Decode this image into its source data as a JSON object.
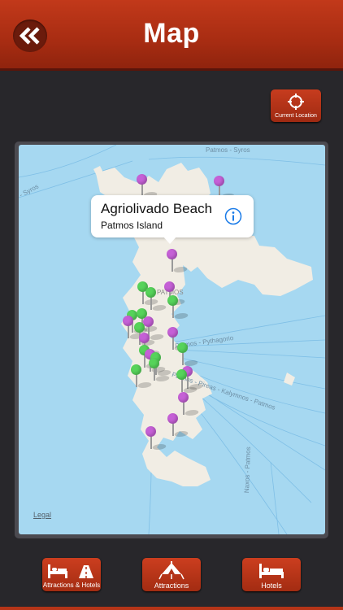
{
  "header": {
    "title": "Map",
    "back_icon": "double-chevron-left-icon"
  },
  "current_location": {
    "label": "Current Location",
    "icon": "crosshair-icon"
  },
  "map": {
    "labels": {
      "patmos_syros": "Patmos - Syros",
      "syros": "- Syros",
      "patmos": "PATMOS",
      "patmos_pythagorio": "Patmos - Pythagorio",
      "patmos_pireas": "Patmos - Pireas - Kalymnos - Patmos",
      "naxos_patmos": "Naxos - Patmos",
      "legal": "Legal"
    },
    "callout": {
      "title": "Agriolivado Beach",
      "subtitle": "Patmos Island",
      "info_icon": "info-icon"
    },
    "pin_colors": {
      "attraction": "#c560d6",
      "hotel": "#56d35a"
    }
  },
  "tabs": [
    {
      "label": "Attractions & Hotels",
      "icon": "bed-and-road-icon"
    },
    {
      "label": "Attractions",
      "icon": "tent-icon"
    },
    {
      "label": "Hotels",
      "icon": "bed-icon"
    }
  ]
}
